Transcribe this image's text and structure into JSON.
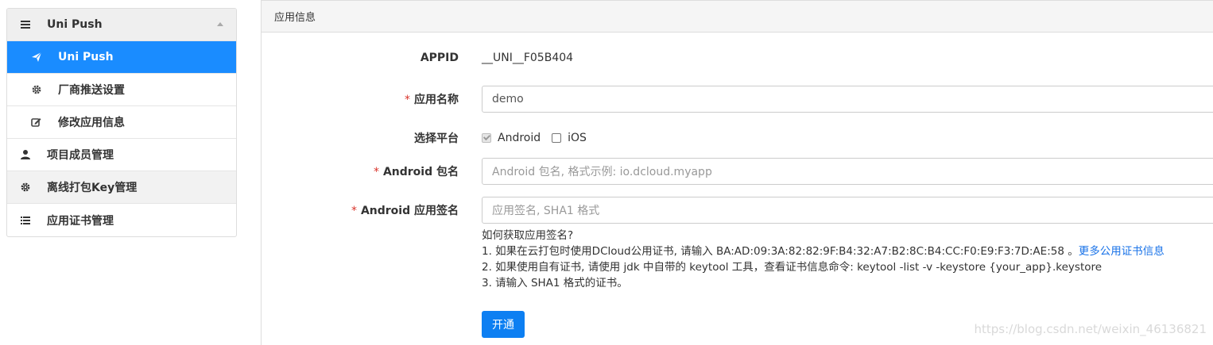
{
  "sidebar": {
    "items": [
      {
        "label": "Uni Push",
        "icon": "menu-icon"
      },
      {
        "label": "Uni Push",
        "icon": "send-icon"
      },
      {
        "label": "厂商推送设置",
        "icon": "gear-icon"
      },
      {
        "label": "修改应用信息",
        "icon": "edit-icon"
      },
      {
        "label": "项目成员管理",
        "icon": "user-icon"
      },
      {
        "label": "离线打包Key管理",
        "icon": "gear-icon"
      },
      {
        "label": "应用证书管理",
        "icon": "list-icon"
      }
    ]
  },
  "panel": {
    "title": "应用信息"
  },
  "form": {
    "appid_label": "APPID",
    "appid_value": "__UNI__F05B404",
    "required_mark": "*",
    "app_name_label": "应用名称",
    "app_name_value": "demo",
    "platform_label": "选择平台",
    "platform_android": "Android",
    "platform_ios": "iOS",
    "android_pkg_label": "Android 包名",
    "android_pkg_placeholder": "Android 包名, 格式示例: io.dcloud.myapp",
    "android_sig_label": "Android 应用签名",
    "android_sig_placeholder": "应用签名, SHA1 格式"
  },
  "help": {
    "q": "如何获取应用签名?",
    "line1": "1. 如果在云打包时使用DCloud公用证书, 请输入 BA:AD:09:3A:82:82:9F:B4:32:A7:B2:8C:B4:CC:F0:E9:F3:7D:AE:58 。",
    "line1_link": "更多公用证书信息",
    "line2": "2. 如果使用自有证书, 请使用 jdk 中自带的 keytool 工具，查看证书信息命令: keytool -list -v -keystore {your_app}.keystore",
    "line3": "3. 请输入 SHA1 格式的证书。"
  },
  "submit_label": "开通",
  "watermark": "https://blog.csdn.net/weixin_46136821",
  "colors": {
    "accent": "#1a8cff",
    "button": "#0d7ff2",
    "required": "#d9342b",
    "link": "#1a73e8"
  }
}
